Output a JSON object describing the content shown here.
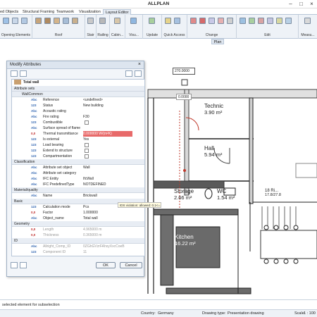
{
  "app": {
    "title": "ALLPLAN"
  },
  "tabs": [
    "ed Objects",
    "Structural Framing",
    "Teamwork",
    "Visualization",
    "Layout Editor"
  ],
  "ribbon_groups": [
    "Opening Elements",
    "Roof",
    "Stair",
    "Railing",
    "Cabin...",
    "Visu...",
    "Update",
    "Quick Access",
    "Change",
    "Edit",
    "Measu..."
  ],
  "plan_tab": "Plan",
  "dialog": {
    "title": "Modify Attributes",
    "header": "Total wall",
    "ok": "OK",
    "cancel": "Cancel",
    "rows": [
      {
        "kind": "section",
        "text": "Attribute sets"
      },
      {
        "kind": "section",
        "text": "WallCommon"
      },
      {
        "type": "Abc",
        "name": "Reference",
        "value": "<undefined>"
      },
      {
        "type": "123",
        "name": "Status",
        "value": "New building"
      },
      {
        "type": "Abc",
        "name": "Acoustic rating",
        "value": ""
      },
      {
        "type": "Abc",
        "name": "Fire rating",
        "value": "F30"
      },
      {
        "type": "123",
        "name": "Combustible",
        "check": true
      },
      {
        "type": "Abc",
        "name": "Surface spread of flame",
        "value": ""
      },
      {
        "type": "0,0",
        "name": "Thermal transmittance",
        "value": "0.000000 W/(m²K)",
        "hl": true
      },
      {
        "type": "123",
        "name": "Is external",
        "value": "Yes"
      },
      {
        "type": "123",
        "name": "Load bearing",
        "check": true
      },
      {
        "type": "123",
        "name": "Extend to structure",
        "check": true
      },
      {
        "type": "123",
        "name": "Compartmentation",
        "check": true
      },
      {
        "kind": "section",
        "text": "Classification"
      },
      {
        "type": "Abc",
        "name": "Attribute set object",
        "value": "Wall"
      },
      {
        "type": "Abc",
        "name": "Attribute set category",
        "value": ""
      },
      {
        "type": "Abc",
        "name": "IFC Entity",
        "value": "IfcWall"
      },
      {
        "type": "Abc",
        "name": "IFC PredefinedType",
        "value": "NOTDEFINED"
      },
      {
        "kind": "section",
        "text": "Material/quality"
      },
      {
        "type": "Abc",
        "name": "Name",
        "value": "Brickwall"
      },
      {
        "kind": "section",
        "text": "Basic"
      },
      {
        "type": "123",
        "name": "Calculation mode",
        "value": "Pcs"
      },
      {
        "type": "0,0",
        "name": "Factor",
        "value": "1.000000"
      },
      {
        "type": "Abc",
        "name": "Object_name",
        "value": "Total wall"
      },
      {
        "kind": "section",
        "text": "Geometry"
      },
      {
        "type": "0,0",
        "name": "Length",
        "value": "4.965000 m",
        "dis": true
      },
      {
        "type": "0,0",
        "name": "Thickness",
        "value": "0.365000 m",
        "dis": true
      },
      {
        "kind": "section",
        "text": "ID"
      },
      {
        "type": "Abc",
        "name": "Allright_Comp_ID",
        "value": "0ZGhGVzrFAhxyXxcCoeB",
        "dis": true
      },
      {
        "type": "123",
        "name": "Component ID",
        "value": "11",
        "dis": true
      }
    ]
  },
  "tooltip": "IDS violation: allowed: 0.1<=...<=0.2",
  "dim_box": "270.0000",
  "dim_small": "0.0000",
  "rooms": [
    {
      "name": "Technic",
      "area": "3.90 m²"
    },
    {
      "name": "Hall",
      "area": "5.94 m²"
    },
    {
      "name": "Storage",
      "area": "2.66 m²"
    },
    {
      "name": "WC",
      "area": "1.54 m²"
    },
    {
      "name": "Kitchen",
      "area": "16.22 m²"
    },
    {
      "name": "18 Ri...",
      "area": "17.8/27.8"
    }
  ],
  "status": "selected element for subselection",
  "bottom": {
    "country_label": "Country:",
    "country": "Germany",
    "drawing_label": "Drawing type:",
    "drawing": "Presentation drawing",
    "scale_label": "Scale:",
    "scale": "1 : 100"
  },
  "colors": {
    "accent": "#2f64b0",
    "highlight": "#e86a6a"
  }
}
